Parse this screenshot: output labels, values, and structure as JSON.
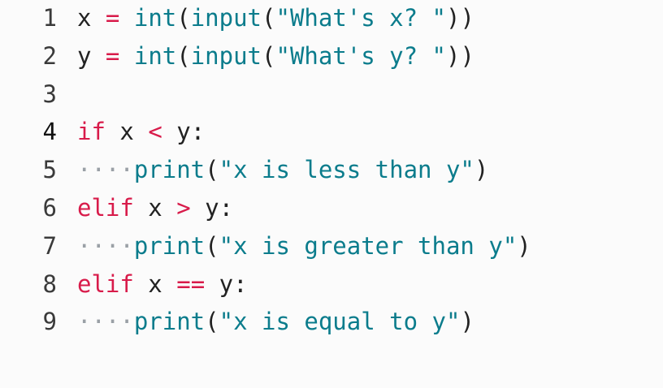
{
  "editor": {
    "colors": {
      "keyword": "#d81b4a",
      "operator": "#d81b4a",
      "builtin": "#0b7c8c",
      "string": "#0b7c8c",
      "text": "#222222",
      "whitespace_dots": "#9aa0a6",
      "background": "#fbfbfb"
    },
    "lines": [
      {
        "number": "1",
        "tokens": [
          {
            "type": "plain",
            "text": "x "
          },
          {
            "type": "op",
            "text": "="
          },
          {
            "type": "plain",
            "text": " "
          },
          {
            "type": "fn",
            "text": "int"
          },
          {
            "type": "plain",
            "text": "("
          },
          {
            "type": "fn",
            "text": "input"
          },
          {
            "type": "plain",
            "text": "("
          },
          {
            "type": "str",
            "text": "\"What's x? \""
          },
          {
            "type": "plain",
            "text": "))"
          }
        ]
      },
      {
        "number": "2",
        "tokens": [
          {
            "type": "plain",
            "text": "y "
          },
          {
            "type": "op",
            "text": "="
          },
          {
            "type": "plain",
            "text": " "
          },
          {
            "type": "fn",
            "text": "int"
          },
          {
            "type": "plain",
            "text": "("
          },
          {
            "type": "fn",
            "text": "input"
          },
          {
            "type": "plain",
            "text": "("
          },
          {
            "type": "str",
            "text": "\"What's y? \""
          },
          {
            "type": "plain",
            "text": "))"
          }
        ]
      },
      {
        "number": "3",
        "tokens": []
      },
      {
        "number": "4",
        "tokens": [
          {
            "type": "kw",
            "text": "if"
          },
          {
            "type": "plain",
            "text": " x "
          },
          {
            "type": "op",
            "text": "<"
          },
          {
            "type": "plain",
            "text": " y:"
          }
        ]
      },
      {
        "number": "5",
        "tokens": [
          {
            "type": "indent",
            "text": "····"
          },
          {
            "type": "fn",
            "text": "print"
          },
          {
            "type": "plain",
            "text": "("
          },
          {
            "type": "str",
            "text": "\"x is less than y\""
          },
          {
            "type": "plain",
            "text": ")"
          }
        ]
      },
      {
        "number": "6",
        "tokens": [
          {
            "type": "kw",
            "text": "elif"
          },
          {
            "type": "plain",
            "text": " x "
          },
          {
            "type": "op",
            "text": ">"
          },
          {
            "type": "plain",
            "text": " y:"
          }
        ]
      },
      {
        "number": "7",
        "tokens": [
          {
            "type": "indent",
            "text": "····"
          },
          {
            "type": "fn",
            "text": "print"
          },
          {
            "type": "plain",
            "text": "("
          },
          {
            "type": "str",
            "text": "\"x is greater than y\""
          },
          {
            "type": "plain",
            "text": ")"
          }
        ]
      },
      {
        "number": "8",
        "tokens": [
          {
            "type": "kw",
            "text": "elif"
          },
          {
            "type": "plain",
            "text": " x "
          },
          {
            "type": "op",
            "text": "=="
          },
          {
            "type": "plain",
            "text": " y:"
          }
        ]
      },
      {
        "number": "9",
        "tokens": [
          {
            "type": "indent",
            "text": "····"
          },
          {
            "type": "fn",
            "text": "print"
          },
          {
            "type": "plain",
            "text": "("
          },
          {
            "type": "str",
            "text": "\"x is equal to y\""
          },
          {
            "type": "plain",
            "text": ")"
          }
        ]
      }
    ]
  }
}
